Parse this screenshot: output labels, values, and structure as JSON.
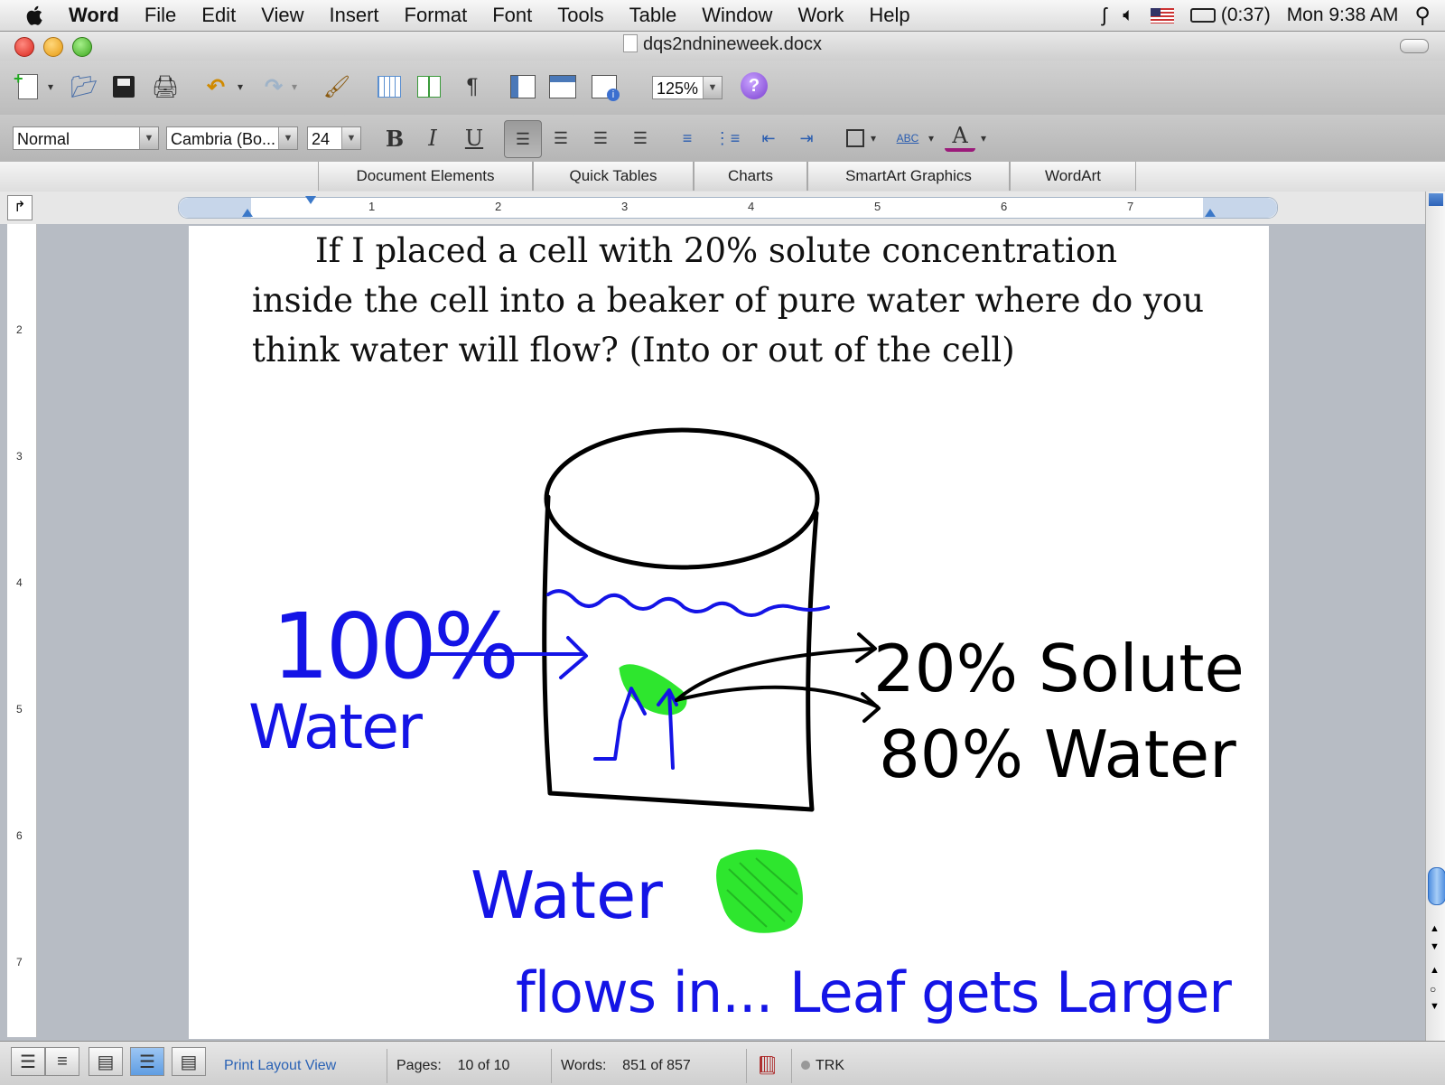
{
  "menubar": {
    "app": "Word",
    "items": [
      "File",
      "Edit",
      "View",
      "Insert",
      "Format",
      "Font",
      "Tools",
      "Table",
      "Window",
      "Work",
      "Help"
    ],
    "battery": "(0:37)",
    "clock": "Mon 9:38 AM"
  },
  "window": {
    "title": "dqs2ndnineweek.docx"
  },
  "toolbar": {
    "zoom": "125%",
    "style": "Normal",
    "font": "Cambria (Bo...",
    "size": "24",
    "bold": "B",
    "italic": "I",
    "underline": "U",
    "pilcrow": "¶",
    "help": "?"
  },
  "gallery": {
    "tabs": [
      "Document Elements",
      "Quick Tables",
      "Charts",
      "SmartArt Graphics",
      "WordArt"
    ]
  },
  "ruler": {
    "numbers": [
      "1",
      "2",
      "3",
      "4",
      "5",
      "6",
      "7"
    ],
    "vnumbers": [
      "2",
      "3",
      "4",
      "5",
      "6",
      "7"
    ]
  },
  "document": {
    "question": "If I placed a cell with 20% solute concentration inside the cell into a beaker of pure water where do you think water will flow? (Into or out of the cell)",
    "drawing": {
      "left_label_1": "100%",
      "left_label_2": "Water",
      "right_label_1": "20% Solute",
      "right_label_2": "80% Water",
      "bottom_label_1": "Water",
      "bottom_label_2": "flows in... Leaf gets Larger"
    },
    "colors": {
      "blue_ink": "#1414e6",
      "green_ink": "#2ee62e",
      "black_ink": "#000000"
    }
  },
  "status": {
    "view": "Print Layout View",
    "pages_label": "Pages:",
    "pages_value": "10 of 10",
    "words_label": "Words:",
    "words_value": "851 of 857",
    "trk": "TRK"
  }
}
